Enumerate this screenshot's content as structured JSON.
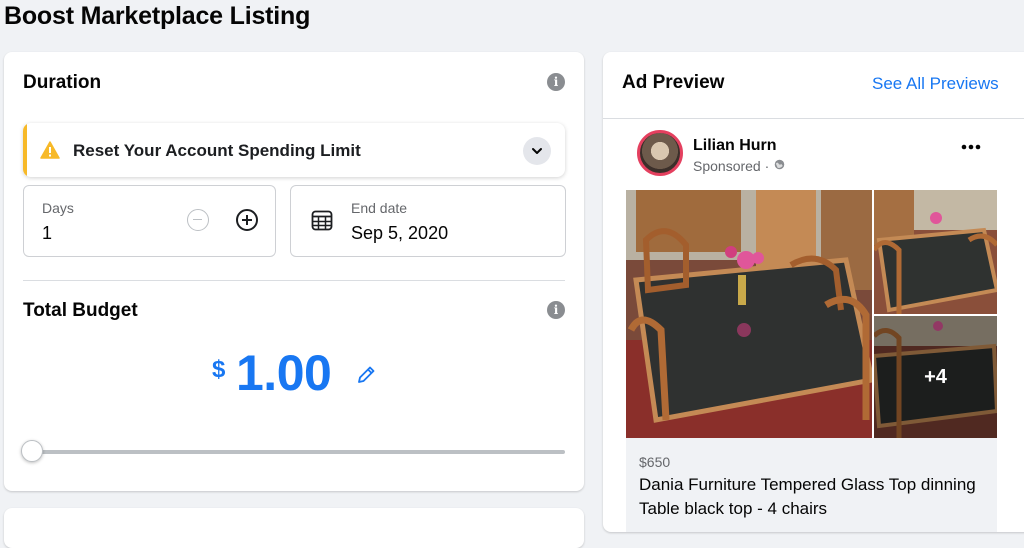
{
  "page": {
    "title": "Boost Marketplace Listing"
  },
  "duration": {
    "title": "Duration",
    "alert": {
      "text": "Reset Your Account Spending Limit",
      "color": "#f7b928"
    },
    "days": {
      "label": "Days",
      "value": "1"
    },
    "end_date": {
      "label": "End date",
      "value": "Sep 5, 2020"
    }
  },
  "budget": {
    "title": "Total Budget",
    "currency": "$",
    "amount": "1.00",
    "slider_fraction": 0.0,
    "accent_color": "#1877f2"
  },
  "preview": {
    "title": "Ad Preview",
    "see_all_label": "See All Previews",
    "author": "Lilian Hurn",
    "sponsored_label": "Sponsored ·",
    "more_photos_label": "+4",
    "price": "$650",
    "listing_title": "Dania Furniture Tempered Glass Top dinning Table black top - 4 chairs"
  },
  "icons": {
    "info": "info-icon",
    "warning": "warning-icon",
    "chevron": "chevron-down-icon",
    "minus": "minus-circle-icon",
    "plus": "plus-circle-icon",
    "calendar": "calendar-icon",
    "pencil": "pencil-icon",
    "globe": "globe-icon",
    "more": "more-icon"
  }
}
